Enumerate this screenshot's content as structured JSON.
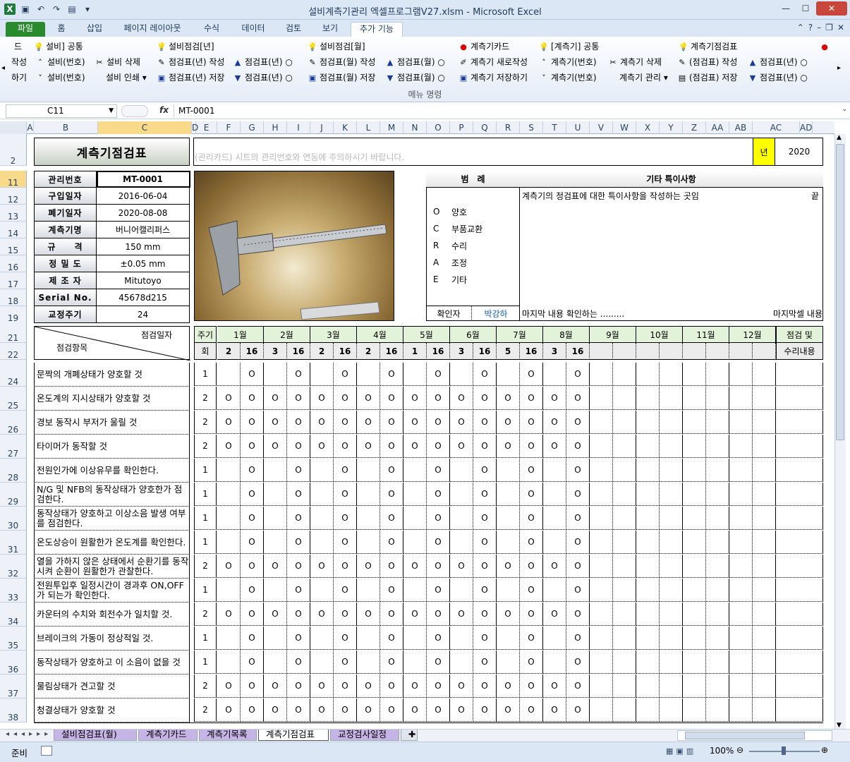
{
  "window": {
    "title": "설비계측기관리 엑셀프로그램V27.xlsm  -  Microsoft Excel"
  },
  "ribbon_tabs": [
    "파일",
    "홈",
    "삽입",
    "페이지 레이아웃",
    "수식",
    "데이터",
    "검토",
    "보기",
    "추가 기능"
  ],
  "ribbon": {
    "row1": [
      "드",
      "설비] 공통",
      "설비점검[년]",
      "설비점검[월]",
      "계측기카드",
      "[계측기] 공통",
      "계측기점검표"
    ],
    "row2": [
      "작성",
      "설비(번호)",
      "설비 삭제",
      "점검표(년) 작성",
      "점검표(년)",
      "점검표(월) 작성",
      "점검표(월)",
      "계측기 새로작성",
      "계측기(번호)",
      "계측기 삭제",
      "(점검표) 작성",
      "점검표(년)"
    ],
    "row3": [
      "하기",
      "설비(번호)",
      "설비 인쇄",
      "점검표(년) 저장",
      "점검표(년)",
      "점검표(월) 저장",
      "점검표(월)",
      "계측기 저장하기",
      "계측기(번호)",
      "계측기 관리",
      "(점검표) 저장",
      "점검표(년)"
    ],
    "group": "메뉴 명령"
  },
  "formula_bar": {
    "cell_ref": "C11",
    "fx": "fx",
    "value": "MT-0001"
  },
  "columns": [
    "A",
    "B",
    "C",
    "D",
    "E",
    "F",
    "G",
    "H",
    "I",
    "J",
    "K",
    "L",
    "M",
    "N",
    "O",
    "P",
    "Q",
    "R",
    "S",
    "T",
    "U",
    "V",
    "W",
    "X",
    "Y",
    "Z",
    "AA",
    "AB",
    "AC",
    "AD"
  ],
  "rows": [
    "2",
    "11",
    "12",
    "13",
    "14",
    "15",
    "16",
    "17",
    "18",
    "19",
    "21",
    "22",
    "24",
    "25",
    "26",
    "27",
    "28",
    "29",
    "30",
    "31",
    "32",
    "33",
    "34",
    "35",
    "36",
    "37",
    "38"
  ],
  "sheet": {
    "title": "계측기점검표",
    "notice": "(관리카드) 시트의 관리번호와 연동에 주의하시기 바랍니다.",
    "year_label": "년",
    "year": "2020",
    "info": [
      {
        "label": "관리번호",
        "value": "MT-0001"
      },
      {
        "label": "구입일자",
        "value": "2016-06-04"
      },
      {
        "label": "폐기일자",
        "value": "2020-08-08"
      },
      {
        "label": "계측기명",
        "value": "버니어캘리퍼스"
      },
      {
        "label": "규　　격",
        "value": "150 mm"
      },
      {
        "label": "정 밀 도",
        "value": "±0.05 mm"
      },
      {
        "label": "제 조 자",
        "value": "Mitutoyo"
      },
      {
        "label": "Serial No.",
        "value": "45678d215"
      },
      {
        "label": "교정주기",
        "value": "24"
      }
    ],
    "legend_title": "범　례",
    "legend": [
      {
        "k": "O",
        "v": "양호"
      },
      {
        "k": "C",
        "v": "부품교환"
      },
      {
        "k": "R",
        "v": "수리"
      },
      {
        "k": "A",
        "v": "조정"
      },
      {
        "k": "E",
        "v": "기타"
      }
    ],
    "confirm_label": "확인자",
    "confirm_name": "박강하",
    "notes_title": "기타 특이사항",
    "notes_text": "계측기의 정검표에 대한 특이사항을 작성하는 곳임",
    "notes_end": "끝",
    "notes_last": "마지막 내용 확인하는 .........",
    "notes_last_right": "마지막셀 내용",
    "hdr_date": "점검일자",
    "hdr_item": "점검항목",
    "hdr_cycle": "주기",
    "hdr_count": "회",
    "months": [
      "1월",
      "2월",
      "3월",
      "4월",
      "5월",
      "6월",
      "7월",
      "8월",
      "9월",
      "10월",
      "11월",
      "12월"
    ],
    "days": [
      "2",
      "16",
      "3",
      "16",
      "2",
      "16",
      "2",
      "16",
      "1",
      "16",
      "3",
      "16",
      "5",
      "16",
      "3",
      "16"
    ],
    "result_hdr1": "점검 및",
    "result_hdr2": "수리내용",
    "items": [
      {
        "text": "문짝의 개폐상태가 양호할 것",
        "cycle": "1"
      },
      {
        "text": "온도계의 지시상태가 양호할 것",
        "cycle": "2"
      },
      {
        "text": "경보 동작시 부저가 울릴 것",
        "cycle": "2"
      },
      {
        "text": "타이머가 동작할 것",
        "cycle": "2"
      },
      {
        "text": "전원인가에 이상유무를 확인한다.",
        "cycle": "1"
      },
      {
        "text": "N/G 및 NFB의 동작상태가 양호한가 점검한다.",
        "cycle": "1"
      },
      {
        "text": "동작상태가 양호하고 이상소음 발생 여부를 점검한다.",
        "cycle": "1"
      },
      {
        "text": "온도상승이 원활한가 온도계를 확인한다.",
        "cycle": "1"
      },
      {
        "text": "열을 가하지 않은 상태에서 순환기를 동작시켜 순환이 원활한가 관찰한다.",
        "cycle": "2"
      },
      {
        "text": "전원투입후 일정시간이 경과후 ON,OFF가 되는가 확인한다.",
        "cycle": "1"
      },
      {
        "text": "카운터의 수치와 회전수가 일치할 것.",
        "cycle": "2"
      },
      {
        "text": "브레이크의 가동이 정상적일 것.",
        "cycle": "1"
      },
      {
        "text": "동작상태가 양호하고 이 소음이 없을 것",
        "cycle": "1"
      },
      {
        "text": "물림상태가 견고할 것",
        "cycle": "2"
      },
      {
        "text": "청결상태가 양호할 것",
        "cycle": "2"
      }
    ],
    "mark": "O"
  },
  "sheet_tabs": [
    "설비점검표(월)",
    "계측기카드",
    "계측기목록",
    "계측기점검표",
    "교정검사일정"
  ],
  "status": {
    "ready": "준비",
    "zoom": "100%"
  }
}
